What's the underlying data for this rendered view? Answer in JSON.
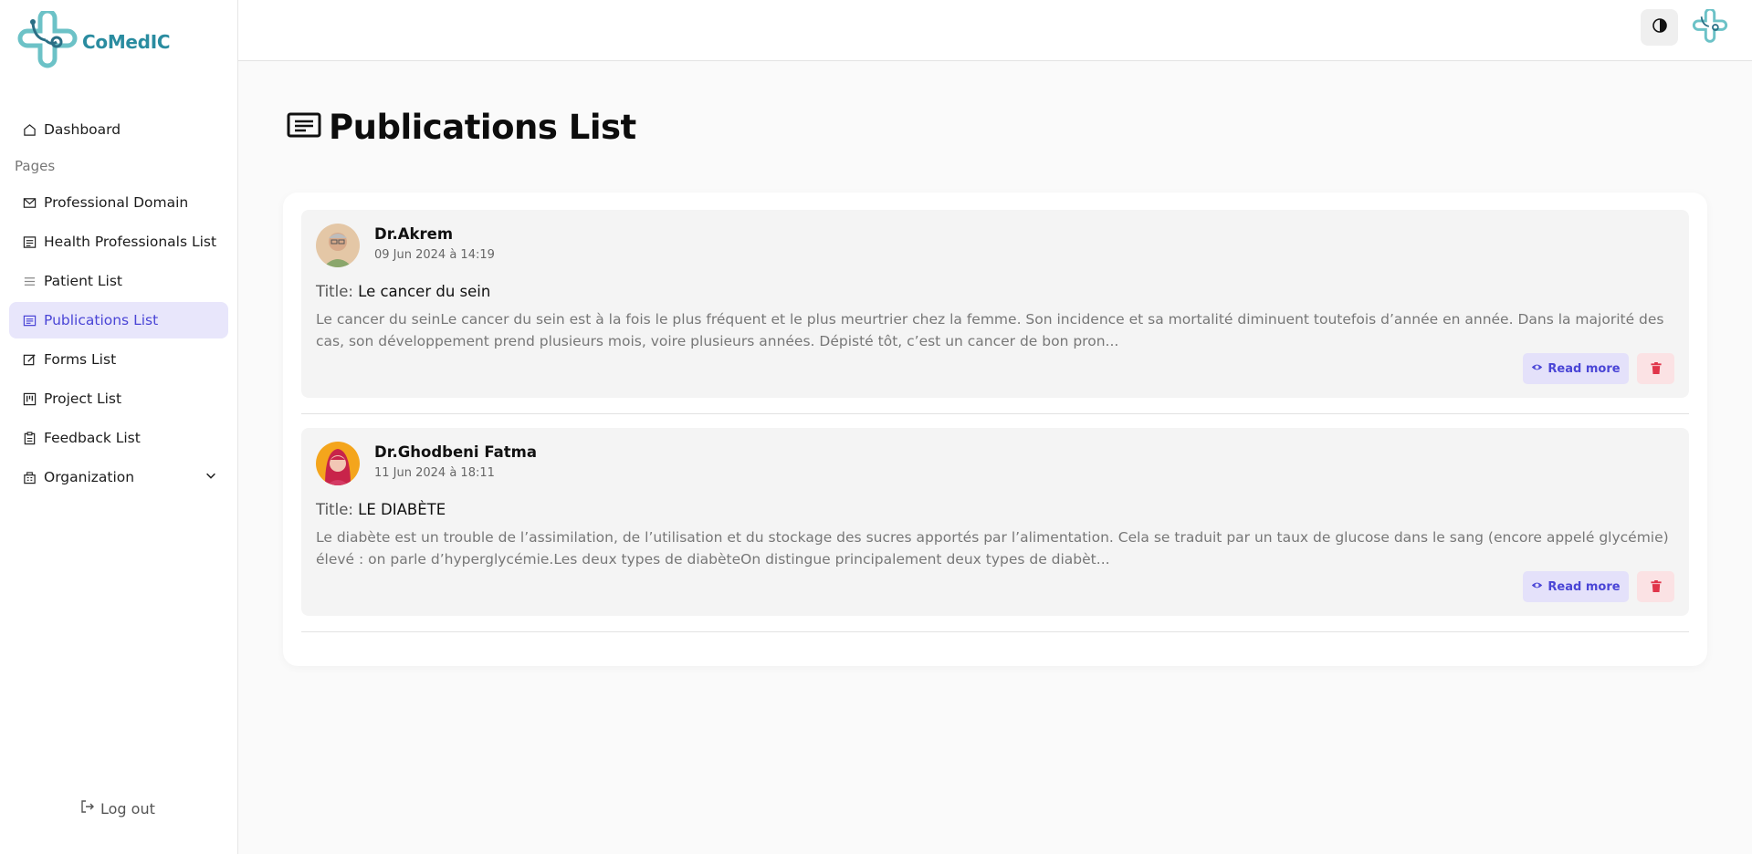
{
  "brand": {
    "name": "CoMedIC",
    "color": "#2a8ca0"
  },
  "sidebar": {
    "dashboard": "Dashboard",
    "section_label": "Pages",
    "items": [
      {
        "label": "Professional Domain",
        "icon": "mail-icon"
      },
      {
        "label": "Health Professionals List",
        "icon": "list-box-icon"
      },
      {
        "label": "Patient List",
        "icon": "lines-icon"
      },
      {
        "label": "Publications List",
        "icon": "document-icon",
        "active": true
      },
      {
        "label": "Forms List",
        "icon": "edit-icon"
      },
      {
        "label": "Project List",
        "icon": "board-icon"
      },
      {
        "label": "Feedback List",
        "icon": "clipboard-icon"
      },
      {
        "label": "Organization",
        "icon": "building-icon"
      }
    ],
    "logout": "Log out"
  },
  "page": {
    "title": "Publications List"
  },
  "colors": {
    "accent": "#4a45d6",
    "accent_bg": "#e8e6fb",
    "danger": "#e0354a"
  },
  "posts": [
    {
      "author": "Dr.Akrem",
      "date": "09 Jun 2024 à 14:19",
      "title_label": "Title:",
      "title": "Le cancer du sein",
      "excerpt": "Le cancer du seinLe cancer du sein est à la fois le plus fréquent et le plus meurtrier chez la femme. Son incidence et sa mortalité diminuent toutefois d’année en année. Dans la majorité des cas, son développement prend plusieurs mois, voire plusieurs années. Dépisté tôt, c’est un cancer de bon pron...",
      "read_more": "Read more"
    },
    {
      "author": "Dr.Ghodbeni Fatma",
      "date": "11 Jun 2024 à 18:11",
      "title_label": "Title:",
      "title": "LE DIABÈTE",
      "excerpt": "Le diabète est un trouble de l’assimilation, de l’utilisation et du stockage des sucres apportés par l’alimentation. Cela se traduit par un taux de glucose dans le sang (encore appelé glycémie) élevé : on parle d’hyperglycémie.Les deux types de diabèteOn distingue principalement deux types de diabèt...",
      "read_more": "Read more"
    }
  ]
}
